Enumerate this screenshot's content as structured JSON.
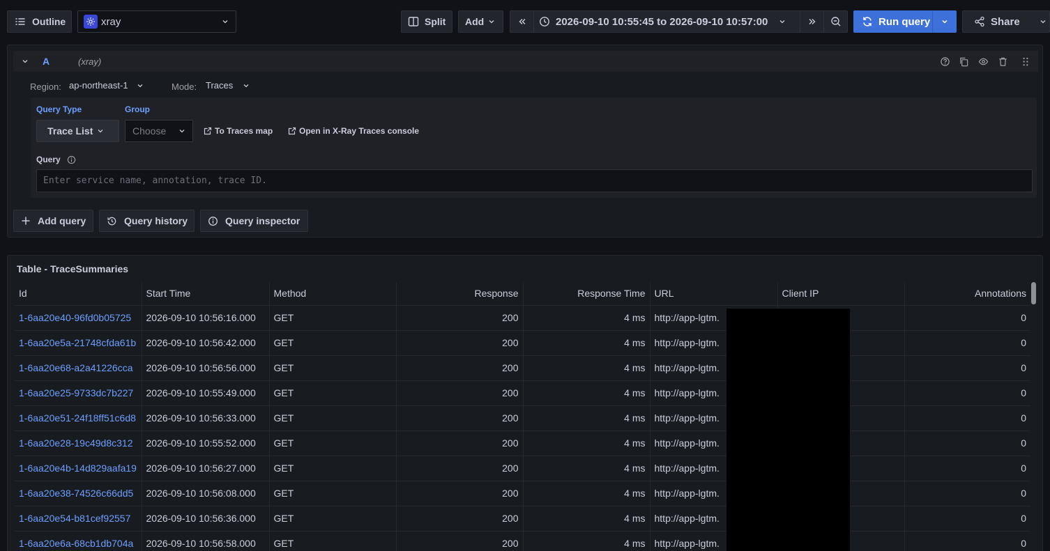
{
  "toolbar": {
    "outline_label": "Outline",
    "datasource": "xray",
    "split_label": "Split",
    "add_label": "Add",
    "time_range": "2026-09-10 10:55:45 to 2026-09-10 10:57:00",
    "run_query_label": "Run query",
    "share_label": "Share"
  },
  "query": {
    "ref_id": "A",
    "datasource_hint": "(xray)",
    "region_label": "Region:",
    "region_value": "ap-northeast-1",
    "mode_label": "Mode:",
    "mode_value": "Traces",
    "query_type_label": "Query Type",
    "query_type_value": "Trace List",
    "group_label": "Group",
    "group_placeholder": "Choose",
    "traces_map_link": "To Traces map",
    "console_link": "Open in X-Ray Traces console",
    "query_label": "Query",
    "query_placeholder": "Enter service name, annotation, trace ID."
  },
  "actions": {
    "add_query": "Add query",
    "query_history": "Query history",
    "query_inspector": "Query inspector"
  },
  "results": {
    "title": "Table - TraceSummaries",
    "columns": [
      "Id",
      "Start Time",
      "Method",
      "Response",
      "Response Time",
      "URL",
      "Client IP",
      "Annotations"
    ],
    "rows": [
      {
        "id": "1-6aa20e40-96fd0b05725",
        "start": "2026-09-10 10:56:16.000",
        "method": "GET",
        "response": "200",
        "rtime": "4 ms",
        "url": "http://app-lgtm.",
        "ip": "",
        "ann": "0"
      },
      {
        "id": "1-6aa20e5a-21748cfda61b",
        "start": "2026-09-10 10:56:42.000",
        "method": "GET",
        "response": "200",
        "rtime": "4 ms",
        "url": "http://app-lgtm.",
        "ip": "",
        "ann": "0"
      },
      {
        "id": "1-6aa20e68-a2a41226cca",
        "start": "2026-09-10 10:56:56.000",
        "method": "GET",
        "response": "200",
        "rtime": "4 ms",
        "url": "http://app-lgtm.",
        "ip": "",
        "ann": "0"
      },
      {
        "id": "1-6aa20e25-9733dc7b227",
        "start": "2026-09-10 10:55:49.000",
        "method": "GET",
        "response": "200",
        "rtime": "4 ms",
        "url": "http://app-lgtm.",
        "ip": "",
        "ann": "0"
      },
      {
        "id": "1-6aa20e51-24f18ff51c6d8",
        "start": "2026-09-10 10:56:33.000",
        "method": "GET",
        "response": "200",
        "rtime": "4 ms",
        "url": "http://app-lgtm.",
        "ip": "",
        "ann": "0"
      },
      {
        "id": "1-6aa20e28-19c49d8c312",
        "start": "2026-09-10 10:55:52.000",
        "method": "GET",
        "response": "200",
        "rtime": "4 ms",
        "url": "http://app-lgtm.",
        "ip": "",
        "ann": "0"
      },
      {
        "id": "1-6aa20e4b-14d829aafa19",
        "start": "2026-09-10 10:56:27.000",
        "method": "GET",
        "response": "200",
        "rtime": "4 ms",
        "url": "http://app-lgtm.",
        "ip": "",
        "ann": "0"
      },
      {
        "id": "1-6aa20e38-74526c66dd5",
        "start": "2026-09-10 10:56:08.000",
        "method": "GET",
        "response": "200",
        "rtime": "4 ms",
        "url": "http://app-lgtm.",
        "ip": "",
        "ann": "0"
      },
      {
        "id": "1-6aa20e54-b81cef92557",
        "start": "2026-09-10 10:56:36.000",
        "method": "GET",
        "response": "200",
        "rtime": "4 ms",
        "url": "http://app-lgtm.",
        "ip": "",
        "ann": "0"
      },
      {
        "id": "1-6aa20e6a-68cb1db704a",
        "start": "2026-09-10 10:56:58.000",
        "method": "GET",
        "response": "200",
        "rtime": "4 ms",
        "url": "http://app-lgtm.",
        "ip": "",
        "ann": "0"
      }
    ]
  },
  "icons": [
    "outline-icon",
    "xray-logo-icon",
    "split-icon",
    "clock-icon",
    "zoom-out-icon",
    "refresh-icon",
    "share-icon",
    "help-icon",
    "copy-icon",
    "eye-icon",
    "trash-icon",
    "drag-handle-icon",
    "external-link-icon",
    "info-icon",
    "plus-icon",
    "history-icon"
  ],
  "colors": {
    "accent": "#3d71d9",
    "link": "#6e9fff",
    "background": "#111217",
    "panel": "#181b1f"
  }
}
